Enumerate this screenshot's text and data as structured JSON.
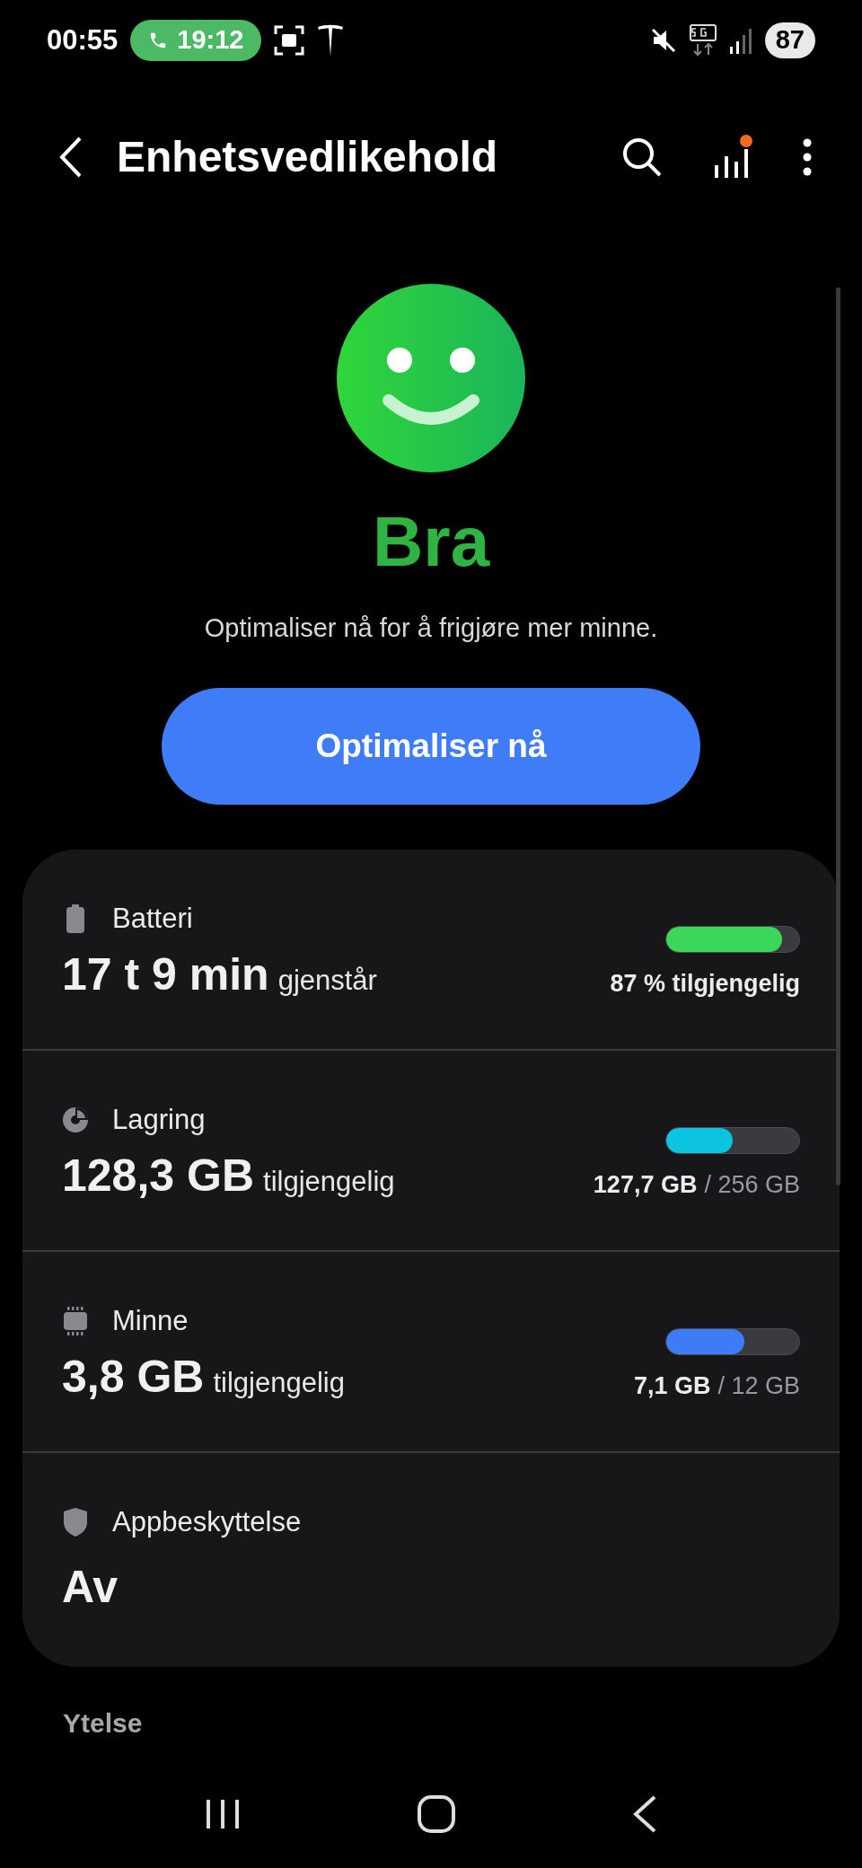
{
  "status_bar": {
    "time": "00:55",
    "call_timer": "19:12",
    "battery": "87"
  },
  "header": {
    "title": "Enhetsvedlikehold",
    "notification_dot": true
  },
  "status": {
    "rating": "Bra",
    "message": "Optimaliser nå for å frigjøre mer minne.",
    "button": "Optimaliser nå"
  },
  "items": [
    {
      "kind": "meter",
      "label": "Batteri",
      "value": "17 t 9 min",
      "unit": "gjenstår",
      "level": 0.87,
      "color": "#3ad75a",
      "reading": "87 % tilgjengelig"
    },
    {
      "kind": "meter",
      "label": "Lagring",
      "value": "128,3 GB",
      "unit": "tilgjengelig",
      "level": 0.5,
      "color": "#0bc4e0",
      "used": "127,7 GB",
      "total": "/ 256 GB"
    },
    {
      "kind": "meter",
      "label": "Minne",
      "value": "3,8 GB",
      "unit": "tilgjengelig",
      "level": 0.59,
      "color": "#3e7bf6",
      "used": "7,1 GB",
      "total": "/ 12 GB"
    },
    {
      "kind": "status",
      "label": "Appbeskyttelse",
      "value": "Av"
    }
  ],
  "section": {
    "title": "Ytelse"
  }
}
